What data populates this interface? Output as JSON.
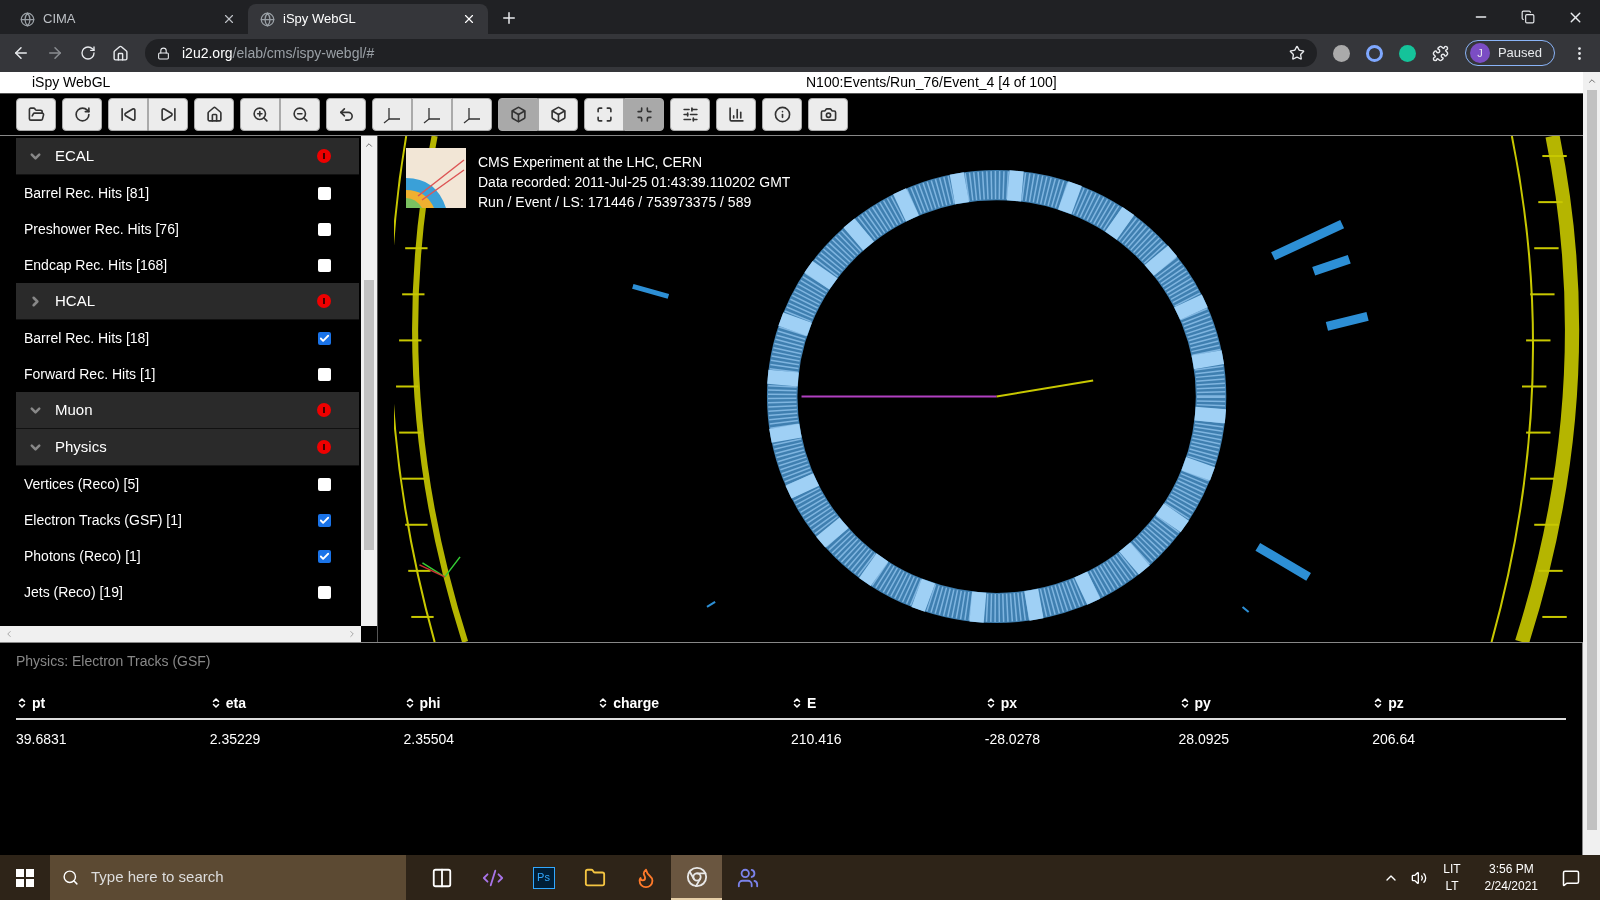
{
  "browser": {
    "tabs": [
      {
        "title": "CIMA",
        "selected": false
      },
      {
        "title": "iSpy WebGL",
        "selected": true
      }
    ],
    "url_host": "i2u2.org",
    "url_path": "/elab/cms/ispy-webgl/#",
    "profile_initial": "J",
    "profile_status": "Paused"
  },
  "app": {
    "title": "iSpy WebGL",
    "event_path": "N100:Events/Run_76/Event_4 [4 of 100]"
  },
  "toolbar": [
    {
      "selected": false
    },
    {
      "selected": false
    },
    {
      "selected": false
    },
    {
      "selected": false
    },
    {
      "selected": false
    },
    {
      "selected": false
    },
    {
      "selected": false
    },
    {
      "selected": false
    },
    {
      "selected": false
    },
    {
      "selected": false
    },
    {
      "selected": false
    },
    {
      "selected": true
    },
    {
      "selected": false
    },
    {
      "selected": false
    },
    {
      "selected": true
    },
    {
      "selected": false
    },
    {
      "selected": false
    },
    {
      "selected": false
    },
    {
      "selected": false
    }
  ],
  "sidebar": {
    "items": [
      {
        "kind": "header",
        "label": "ECAL",
        "expanded": true
      },
      {
        "kind": "item",
        "label": "Barrel Rec. Hits [81]",
        "checked": false
      },
      {
        "kind": "item",
        "label": "Preshower Rec. Hits [76]",
        "checked": false
      },
      {
        "kind": "item",
        "label": "Endcap Rec. Hits [168]",
        "checked": false
      },
      {
        "kind": "header",
        "label": "HCAL",
        "expanded": false
      },
      {
        "kind": "item",
        "label": "Barrel Rec. Hits [18]",
        "checked": true
      },
      {
        "kind": "item",
        "label": "Forward Rec. Hits [1]",
        "checked": false
      },
      {
        "kind": "header",
        "label": "Muon",
        "expanded": true
      },
      {
        "kind": "header",
        "label": "Physics",
        "expanded": true
      },
      {
        "kind": "item",
        "label": "Vertices (Reco) [5]",
        "checked": false
      },
      {
        "kind": "item",
        "label": "Electron Tracks (GSF) [1]",
        "checked": true
      },
      {
        "kind": "item",
        "label": "Photons (Reco) [1]",
        "checked": true
      },
      {
        "kind": "item",
        "label": "Jets (Reco) [19]",
        "checked": false
      }
    ]
  },
  "event_info": [
    "CMS Experiment at the LHC, CERN",
    "Data recorded: 2011-Jul-25 01:43:39.110202 GMT",
    "Run / Event / LS: 171446 / 753973375 / 589"
  ],
  "table": {
    "caption": "Physics: Electron Tracks (GSF)",
    "columns": [
      "pt",
      "eta",
      "phi",
      "charge",
      "E",
      "px",
      "py",
      "pz"
    ],
    "rows": [
      [
        "39.6831",
        "2.35229",
        "2.35504",
        "",
        "210.416",
        "-28.0278",
        "28.0925",
        "206.64"
      ]
    ]
  },
  "taskbar": {
    "search_placeholder": "Type here to search",
    "apps": [
      {
        "active": false
      },
      {
        "active": false
      },
      {
        "active": false
      },
      {
        "active": false
      },
      {
        "active": false
      },
      {
        "active": true
      },
      {
        "active": false
      }
    ],
    "ps_label": "Ps",
    "language": [
      "LIT",
      "LT"
    ],
    "time": "3:56 PM",
    "date": "2/24/2021"
  }
}
